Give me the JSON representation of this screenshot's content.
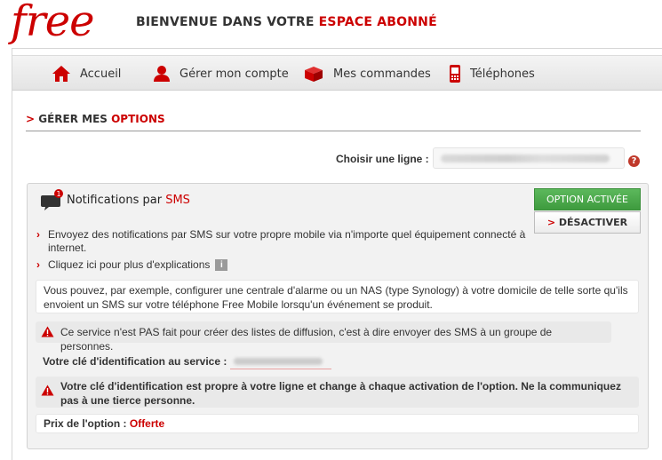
{
  "header": {
    "logo": "free",
    "welcome_prefix": "BIENVENUE DANS VOTRE ",
    "welcome_accent": "ESPACE ABONNÉ"
  },
  "nav": {
    "items": [
      {
        "label": "Accueil",
        "icon": "home-icon"
      },
      {
        "label": "Gérer mon compte",
        "icon": "user-icon"
      },
      {
        "label": "Mes commandes",
        "icon": "box-icon"
      },
      {
        "label": "Téléphones",
        "icon": "phone-icon"
      }
    ]
  },
  "page": {
    "title_arrow": ">",
    "title_prefix": " GÉRER MES ",
    "title_accent": "OPTIONS",
    "line_label": "Choisir une ligne :",
    "help_glyph": "?"
  },
  "option": {
    "title_prefix": "Notifications par ",
    "title_accent": "SMS",
    "badge_count": "1",
    "status_button": "OPTION ACTIVÉE",
    "deactivate_arrow": ">",
    "deactivate_label": " DÉSACTIVER",
    "bullets": [
      {
        "text": "Envoyez des notifications par SMS sur votre propre mobile via n'importe quel équipement connecté à internet."
      },
      {
        "text": "Cliquez ici pour plus d'explications"
      }
    ],
    "info_glyph": "i",
    "example_text": "Vous pouvez, par exemple, configurer une centrale d'alarme ou un NAS (type Synology) à votre domicile de telle sorte qu'ils envoient un SMS sur votre téléphone Free Mobile lorsqu'un événement se produit.",
    "warning_1": "Ce service n'est PAS fait pour créer des listes de diffusion, c'est à dire envoyer des SMS à un groupe de personnes.",
    "key_label": "Votre clé d'identification au service :",
    "warning_2": "Votre clé d'identification est propre à votre ligne et change à chaque activation de l'option. Ne la communiquez pas à une tierce personne.",
    "price_label": "Prix de l'option : ",
    "price_value": "Offerte"
  },
  "colors": {
    "brand_red": "#cc0000",
    "active_green": "#4cae4c"
  }
}
